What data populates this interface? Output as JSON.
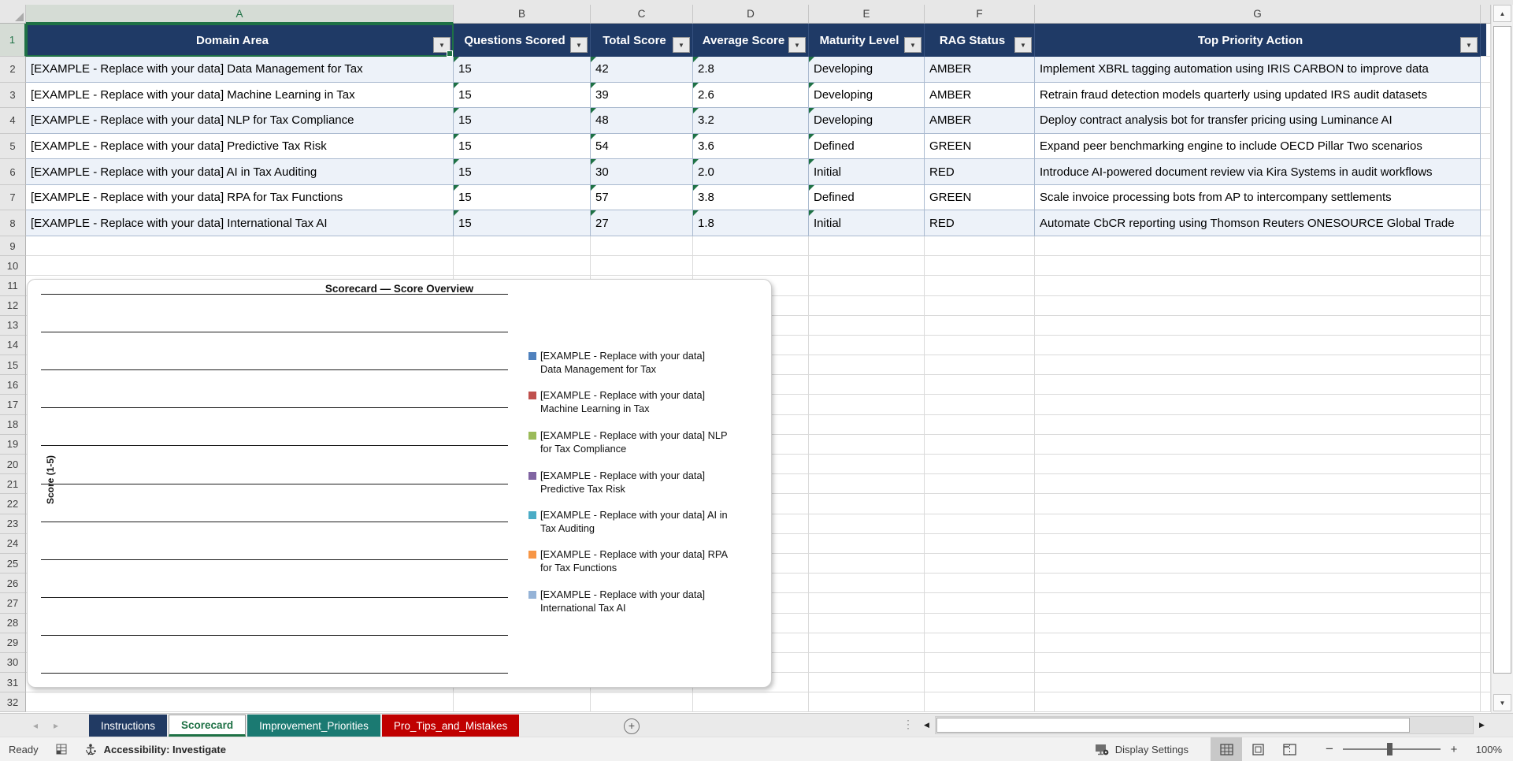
{
  "sheet": {
    "selected_cell": "A1",
    "column_letters": [
      "A",
      "B",
      "C",
      "D",
      "E",
      "F",
      "G"
    ],
    "first_row": 1,
    "last_row": 32
  },
  "table": {
    "header_bg": "#1F3A66",
    "band_color": "#EDF2F9",
    "headers": [
      "Domain Area",
      "Questions Scored",
      "Total Score",
      "Average Score",
      "Maturity Level",
      "RAG Status",
      "Top Priority Action"
    ],
    "rows": [
      {
        "domain": "[EXAMPLE - Replace with your data] Data Management for Tax",
        "questions": "15",
        "total": "42",
        "avg": "2.8",
        "maturity": "Developing",
        "rag": "AMBER",
        "action": "Implement XBRL tagging automation using IRIS CARBON to improve data"
      },
      {
        "domain": "[EXAMPLE - Replace with your data] Machine Learning in Tax",
        "questions": "15",
        "total": "39",
        "avg": "2.6",
        "maturity": "Developing",
        "rag": "AMBER",
        "action": "Retrain fraud detection models quarterly using updated IRS audit datasets"
      },
      {
        "domain": "[EXAMPLE - Replace with your data] NLP for Tax Compliance",
        "questions": "15",
        "total": "48",
        "avg": "3.2",
        "maturity": "Developing",
        "rag": "AMBER",
        "action": "Deploy contract analysis bot for transfer pricing using Luminance AI"
      },
      {
        "domain": "[EXAMPLE - Replace with your data] Predictive Tax Risk",
        "questions": "15",
        "total": "54",
        "avg": "3.6",
        "maturity": "Defined",
        "rag": "GREEN",
        "action": "Expand peer benchmarking engine to include OECD Pillar Two scenarios"
      },
      {
        "domain": "[EXAMPLE - Replace with your data] AI in Tax Auditing",
        "questions": "15",
        "total": "30",
        "avg": "2.0",
        "maturity": "Initial",
        "rag": "RED",
        "action": "Introduce AI-powered document review via Kira Systems in audit workflows"
      },
      {
        "domain": "[EXAMPLE - Replace with your data] RPA for Tax Functions",
        "questions": "15",
        "total": "57",
        "avg": "3.8",
        "maturity": "Defined",
        "rag": "GREEN",
        "action": "Scale invoice processing bots from AP to intercompany settlements"
      },
      {
        "domain": "[EXAMPLE - Replace with your data] International Tax AI",
        "questions": "15",
        "total": "27",
        "avg": "1.8",
        "maturity": "Initial",
        "rag": "RED",
        "action": "Automate CbCR reporting using Thomson Reuters ONESOURCE Global Trade"
      }
    ]
  },
  "chart_data": {
    "type": "bar",
    "title": "Scorecard — Score Overview",
    "ylabel": "Score (1-5)",
    "legend_position": "right",
    "plot_area_empty": true,
    "gridline_count": 11,
    "series": [
      {
        "name": "[EXAMPLE - Replace with your data] Data Management for Tax",
        "color": "#4F81BD"
      },
      {
        "name": "[EXAMPLE - Replace with your data] Machine Learning in Tax",
        "color": "#C0504D"
      },
      {
        "name": "[EXAMPLE - Replace with your data] NLP for Tax Compliance",
        "color": "#9BBB59"
      },
      {
        "name": "[EXAMPLE - Replace with your data] Predictive Tax Risk",
        "color": "#8064A2"
      },
      {
        "name": "[EXAMPLE - Replace with your data] AI in Tax Auditing",
        "color": "#4BACC6"
      },
      {
        "name": "[EXAMPLE - Replace with your data] RPA for Tax Functions",
        "color": "#F79646"
      },
      {
        "name": "[EXAMPLE - Replace with your data] International Tax AI",
        "color": "#95B3D7"
      }
    ]
  },
  "tabs": {
    "items": [
      {
        "label": "Instructions",
        "bg": "#213A63",
        "fg": "#FFFFFF",
        "active": false
      },
      {
        "label": "Scorecard",
        "bg": "#FFFFFF",
        "fg": "#1E7145",
        "active": true
      },
      {
        "label": "Improvement_Priorities",
        "bg": "#1B7A72",
        "fg": "#FFFFFF",
        "active": false
      },
      {
        "label": "Pro_Tips_and_Mistakes",
        "bg": "#C00000",
        "fg": "#FFFFFF",
        "active": false
      }
    ],
    "new_sheet_label": "+"
  },
  "status_bar": {
    "mode": "Ready",
    "accessibility": "Accessibility: Investigate",
    "display_settings": "Display Settings",
    "zoom_level": "100%"
  }
}
